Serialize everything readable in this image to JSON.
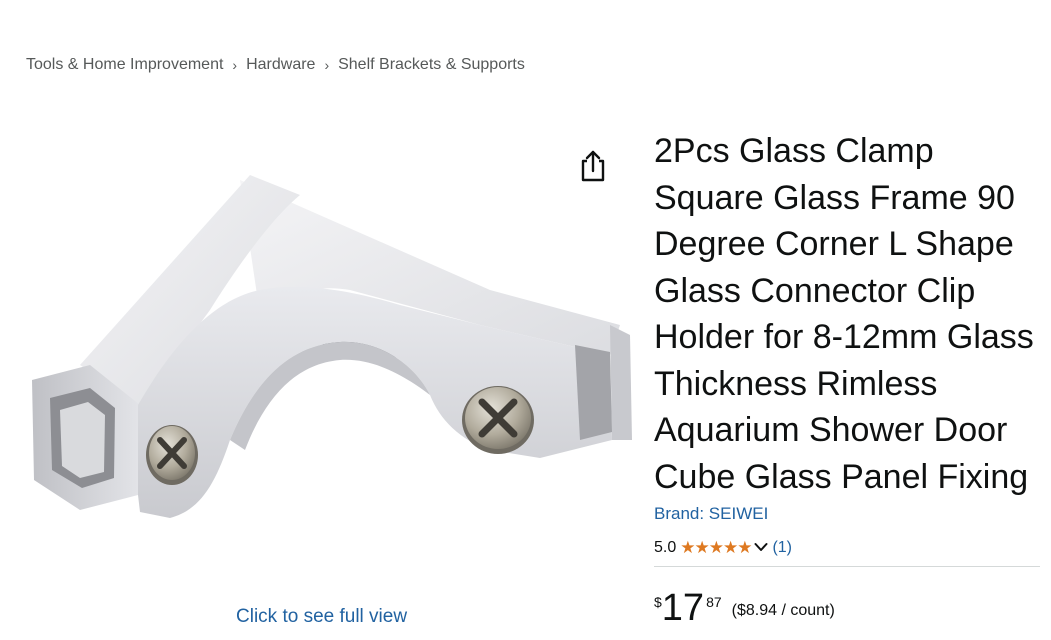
{
  "breadcrumb": {
    "items": [
      "Tools & Home Improvement",
      "Hardware",
      "Shelf Brackets & Supports"
    ],
    "separator": "›"
  },
  "product": {
    "title": "2Pcs Glass Clamp Square Glass Frame 90 Degree Corner L Shape Glass Connector Clip Holder for 8-12mm Glass Thickness Rimless Aquarium Shower Door Cube Glass Panel Fixing",
    "brand": "Brand: SEIWEI",
    "rating_value": "5.0",
    "stars_glyphs": "★★★★★",
    "review_count": "(1)",
    "price_symbol": "$",
    "price_whole": "17",
    "price_fraction": "87",
    "price_per_unit": "($8.94 / count)"
  },
  "image": {
    "full_view_link": "Click to see full view"
  },
  "icons": {
    "share": "share-icon",
    "chevron": "chevron-down-icon",
    "star": "star-icon"
  },
  "colors": {
    "link": "#2162a1",
    "star": "#de7921",
    "text": "#0f1111",
    "muted": "#565959"
  }
}
